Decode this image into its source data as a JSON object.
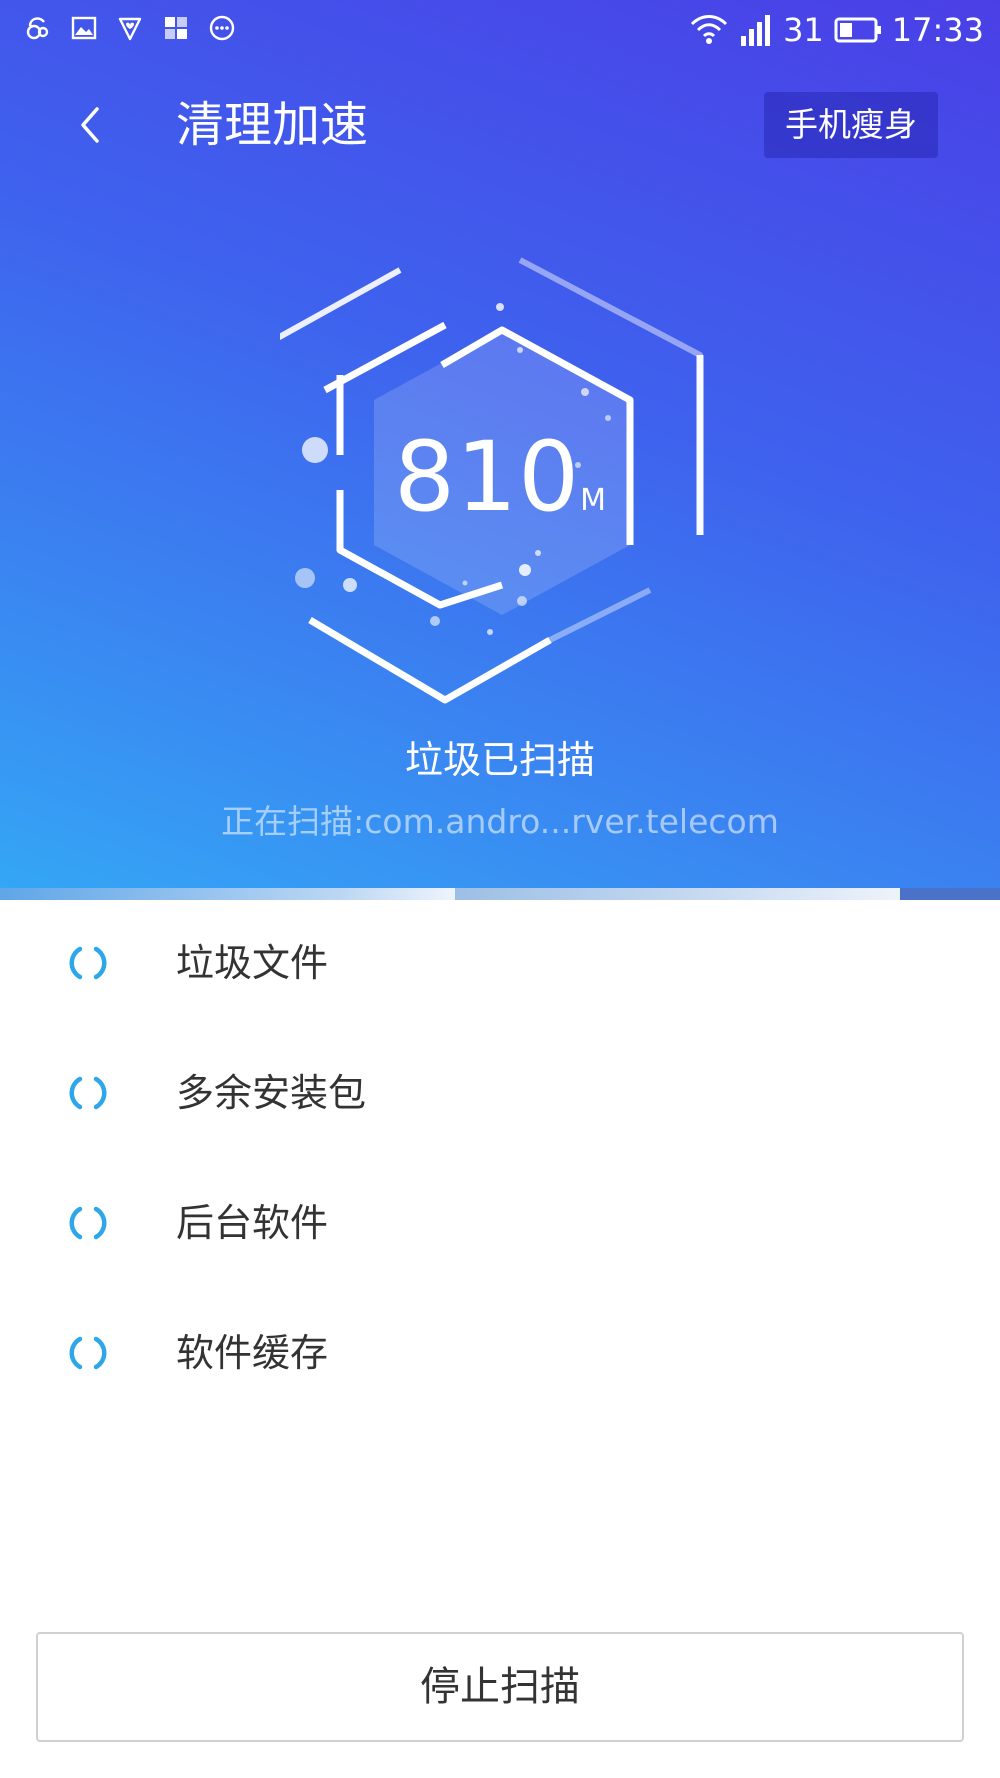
{
  "status_bar": {
    "left_icons": [
      "uc-browser-icon",
      "gallery-icon",
      "shield-heart-icon",
      "apps-grid-icon",
      "more-dots-icon"
    ],
    "right_icons": [
      "wifi-icon",
      "signal-icon"
    ],
    "battery_level": "31",
    "time": "17:33"
  },
  "header": {
    "back_icon": "back-chevron-icon",
    "title": "清理加速",
    "action_label": "手机瘦身"
  },
  "scan": {
    "size_value": "810",
    "size_unit": "M",
    "status_label": "垃圾已扫描",
    "current_target": "正在扫描:com.andro...rver.telecom"
  },
  "categories": [
    {
      "label": "垃圾文件",
      "icon": "loading-spinner-icon"
    },
    {
      "label": "多余安装包",
      "icon": "loading-spinner-icon"
    },
    {
      "label": "后台软件",
      "icon": "loading-spinner-icon"
    },
    {
      "label": "软件缓存",
      "icon": "loading-spinner-icon"
    }
  ],
  "footer": {
    "stop_label": "停止扫描"
  },
  "colors": {
    "hero_top": "#4a3fe6",
    "hero_bottom": "#34a6f5",
    "spinner": "#2ea7ea",
    "text_dark": "#333333"
  }
}
